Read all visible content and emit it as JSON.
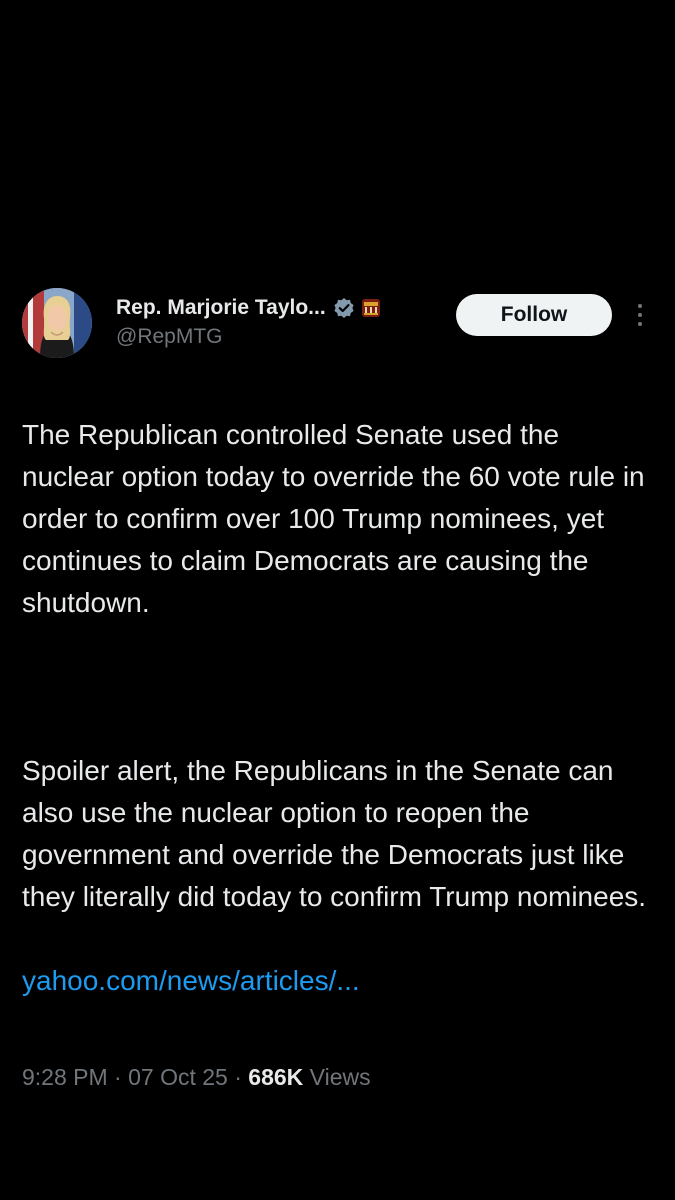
{
  "author": {
    "display_name": "Rep. Marjorie Taylo...",
    "handle": "@RepMTG",
    "avatar_icon": "profile-photo",
    "verified_icon": "verified-badge-icon",
    "affiliation_icon": "government-affiliation-icon"
  },
  "actions": {
    "follow_label": "Follow",
    "more_icon": "more-options-icon"
  },
  "tweet": {
    "paragraph_1": "The Republican controlled Senate used the nuclear option today to override the 60 vote rule in order to confirm over 100 Trump nominees, yet continues to claim Democrats are causing the shutdown.",
    "paragraph_2": "Spoiler alert, the Republicans in the Senate can also use the nuclear option to reopen the government and override the Democrats just like they literally did today to confirm Trump nominees.",
    "link_text": "yahoo.com/news/articles/..."
  },
  "meta": {
    "time": "9:28 PM",
    "separator": " · ",
    "date": "07 Oct 25",
    "views_count": "686K",
    "views_label": " Views"
  },
  "colors": {
    "background": "#000000",
    "text": "#e7e9ea",
    "secondary": "#71767b",
    "link": "#1d9bf0",
    "follow_bg": "#eff3f4"
  }
}
